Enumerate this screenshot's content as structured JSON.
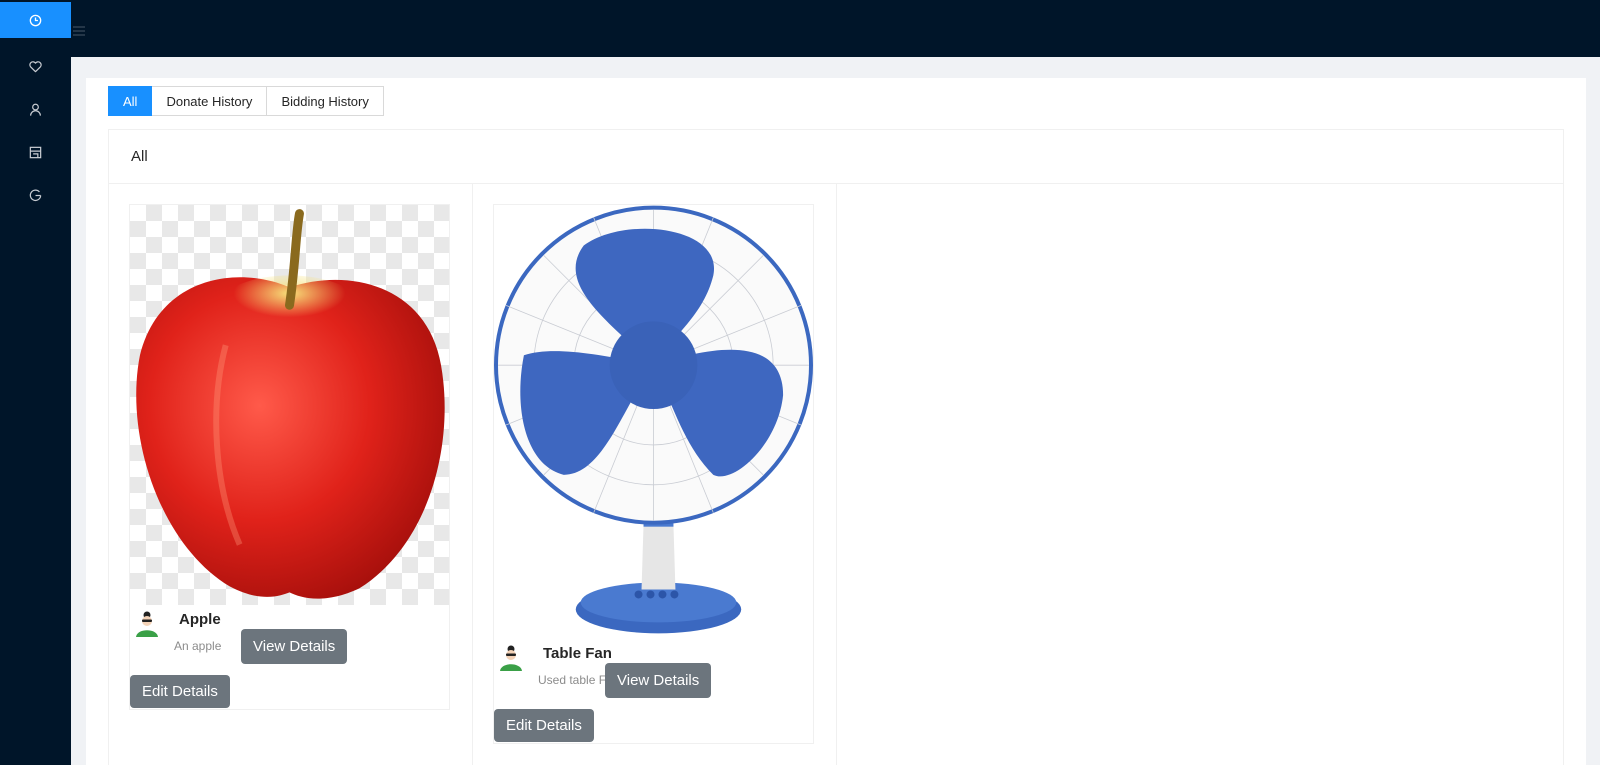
{
  "sidebar": {
    "items": [
      {
        "icon": "history-icon",
        "active": true
      },
      {
        "icon": "heart-icon",
        "active": false
      },
      {
        "icon": "user-icon",
        "active": false
      },
      {
        "icon": "shop-icon",
        "active": false
      },
      {
        "icon": "logout-icon",
        "active": false
      }
    ]
  },
  "header": {
    "toggle_icon": "menu-fold-icon"
  },
  "tabs": [
    {
      "label": "All",
      "active": true
    },
    {
      "label": "Donate History",
      "active": false
    },
    {
      "label": "Bidding History",
      "active": false
    }
  ],
  "section": {
    "title": "All"
  },
  "cards": [
    {
      "title": "Apple",
      "description": "An apple",
      "view_label": "View Details",
      "edit_label": "Edit Details",
      "image": "apple"
    },
    {
      "title": "Table Fan",
      "description": "Used table Fan",
      "view_label": "View Details",
      "edit_label": "Edit Details",
      "image": "table-fan"
    }
  ],
  "colors": {
    "sidebar_bg": "#001529",
    "accent": "#1890ff",
    "button_bg": "#6c757d"
  }
}
